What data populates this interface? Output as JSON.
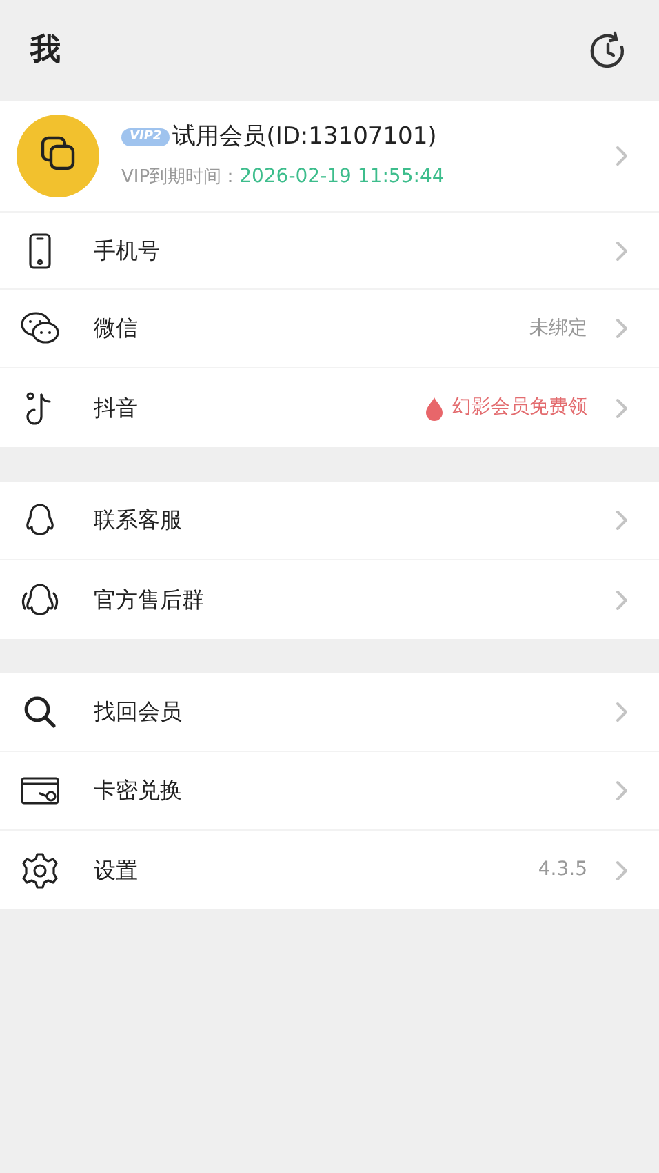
{
  "header": {
    "title": "我"
  },
  "profile": {
    "badge": "VIP2",
    "name": "试用会员(ID:13107101)",
    "expiry_label": "VIP到期时间：",
    "expiry_value": "2026-02-19 11:55:44"
  },
  "groups": [
    {
      "items": [
        {
          "label": "手机号",
          "kind": "plain"
        },
        {
          "label": "微信",
          "kind": "value",
          "value": "未绑定"
        },
        {
          "label": "抖音",
          "kind": "promo",
          "value": "幻影会员免费领"
        }
      ]
    },
    {
      "items": [
        {
          "label": "联系客服",
          "kind": "plain"
        },
        {
          "label": "官方售后群",
          "kind": "plain"
        }
      ]
    },
    {
      "items": [
        {
          "label": "找回会员",
          "kind": "plain"
        },
        {
          "label": "卡密兑换",
          "kind": "plain"
        },
        {
          "label": "设置",
          "kind": "value",
          "value": "4.3.5"
        }
      ]
    }
  ]
}
